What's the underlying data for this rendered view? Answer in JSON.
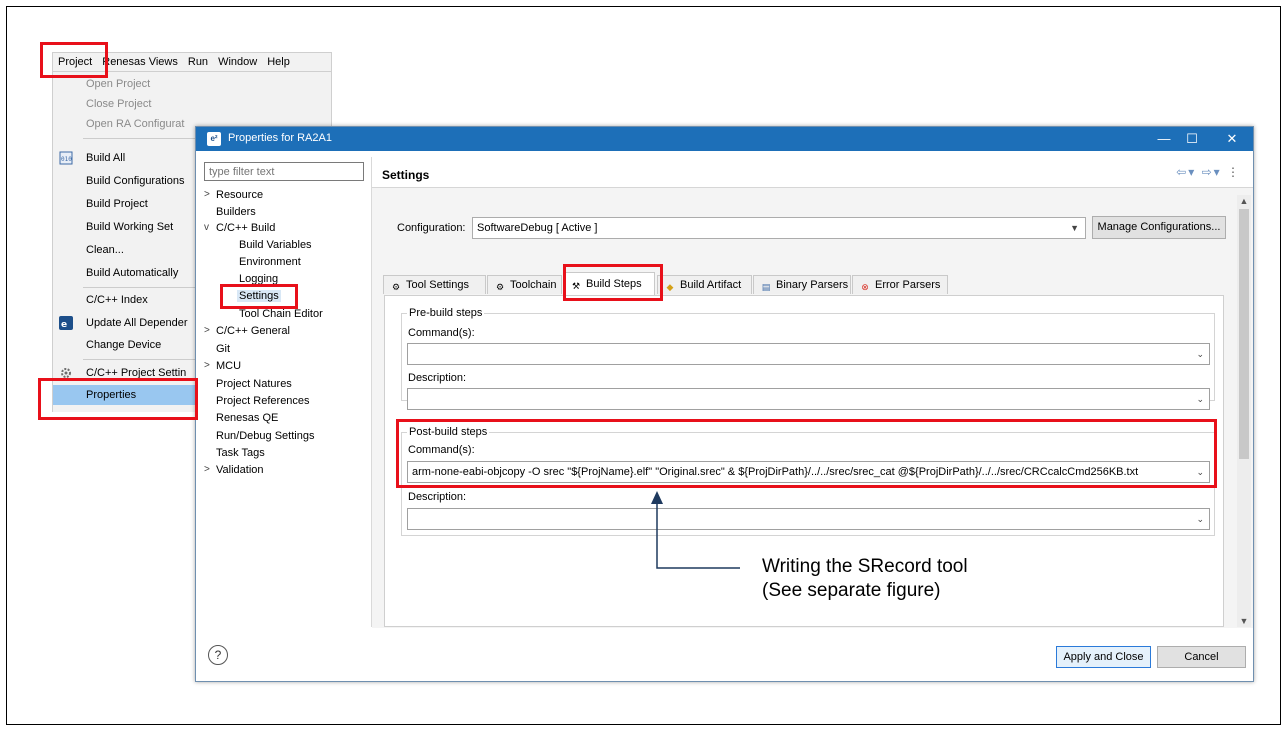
{
  "menubar": [
    "Project",
    "Renesas Views",
    "Run",
    "Window",
    "Help"
  ],
  "menu": [
    {
      "label": "Open Project",
      "disabled": true
    },
    {
      "label": "Close Project",
      "disabled": true
    },
    {
      "label": "Open RA Configurat",
      "disabled": true
    },
    {
      "label": "Build All",
      "icon": "binary-icon"
    },
    {
      "label": "Build Configurations"
    },
    {
      "label": "Build Project"
    },
    {
      "label": "Build Working Set"
    },
    {
      "label": "Clean..."
    },
    {
      "label": "Build Automatically"
    },
    {
      "label": "C/C++ Index"
    },
    {
      "label": "Update All Depender",
      "icon": "e2-icon"
    },
    {
      "label": "Change Device"
    },
    {
      "label": "C/C++ Project Settin",
      "icon": "settings-icon"
    },
    {
      "label": "Properties",
      "selected": true
    }
  ],
  "dialog": {
    "title": "Properties for RA2A1",
    "app_icon": "e²",
    "min": "—",
    "max": "☐",
    "close": "✕"
  },
  "filter_placeholder": "type filter text",
  "tree": [
    {
      "label": "Resource",
      "level": 0,
      "chevron": ">"
    },
    {
      "label": "Builders",
      "level": 0
    },
    {
      "label": "C/C++ Build",
      "level": 0,
      "chevron": "v"
    },
    {
      "label": "Build Variables",
      "level": 1
    },
    {
      "label": "Environment",
      "level": 1
    },
    {
      "label": "Logging",
      "level": 1
    },
    {
      "label": "Settings",
      "level": 1,
      "selected": true
    },
    {
      "label": "Tool Chain Editor",
      "level": 1
    },
    {
      "label": "C/C++ General",
      "level": 0,
      "chevron": ">"
    },
    {
      "label": "Git",
      "level": 0
    },
    {
      "label": "MCU",
      "level": 0,
      "chevron": ">"
    },
    {
      "label": "Project Natures",
      "level": 0
    },
    {
      "label": "Project References",
      "level": 0
    },
    {
      "label": "Renesas QE",
      "level": 0
    },
    {
      "label": "Run/Debug Settings",
      "level": 0
    },
    {
      "label": "Task Tags",
      "level": 0
    },
    {
      "label": "Validation",
      "level": 0,
      "chevron": ">"
    }
  ],
  "settings_title": "Settings",
  "configuration": {
    "label": "Configuration:",
    "value": "SoftwareDebug  [ Active ]",
    "manage_label": "Manage Configurations..."
  },
  "tabs": [
    {
      "label": "Tool Settings",
      "icon": "gear-icon"
    },
    {
      "label": "Toolchain",
      "icon": "gear-icon"
    },
    {
      "label": "Build Steps",
      "icon": "hammer-icon",
      "active": true
    },
    {
      "label": "Build Artifact",
      "icon": "artifact-icon"
    },
    {
      "label": "Binary Parsers",
      "icon": "binary-icon"
    },
    {
      "label": "Error Parsers",
      "icon": "error-icon"
    }
  ],
  "pre_build": {
    "title": "Pre-build steps",
    "command_label": "Command(s):",
    "command_value": "",
    "description_label": "Description:",
    "description_value": ""
  },
  "post_build": {
    "title": "Post-build steps",
    "command_label": "Command(s):",
    "command_value": "arm-none-eabi-objcopy -O srec \"${ProjName}.elf\"  \"Original.srec\"  & ${ProjDirPath}/../../srec/srec_cat  @${ProjDirPath}/../../srec/CRCcalcCmd256KB.txt",
    "description_label": "Description:",
    "description_value": ""
  },
  "buttons": {
    "apply_label": "Apply and Close",
    "cancel_label": "Cancel",
    "help": "?"
  },
  "annotation": {
    "line1": "Writing the SRecord tool",
    "line2": "(See separate figure)"
  },
  "colors": {
    "highlight": "#e8101a",
    "titlebar": "#1d6fb8",
    "arrow": "#1f3a5f"
  }
}
